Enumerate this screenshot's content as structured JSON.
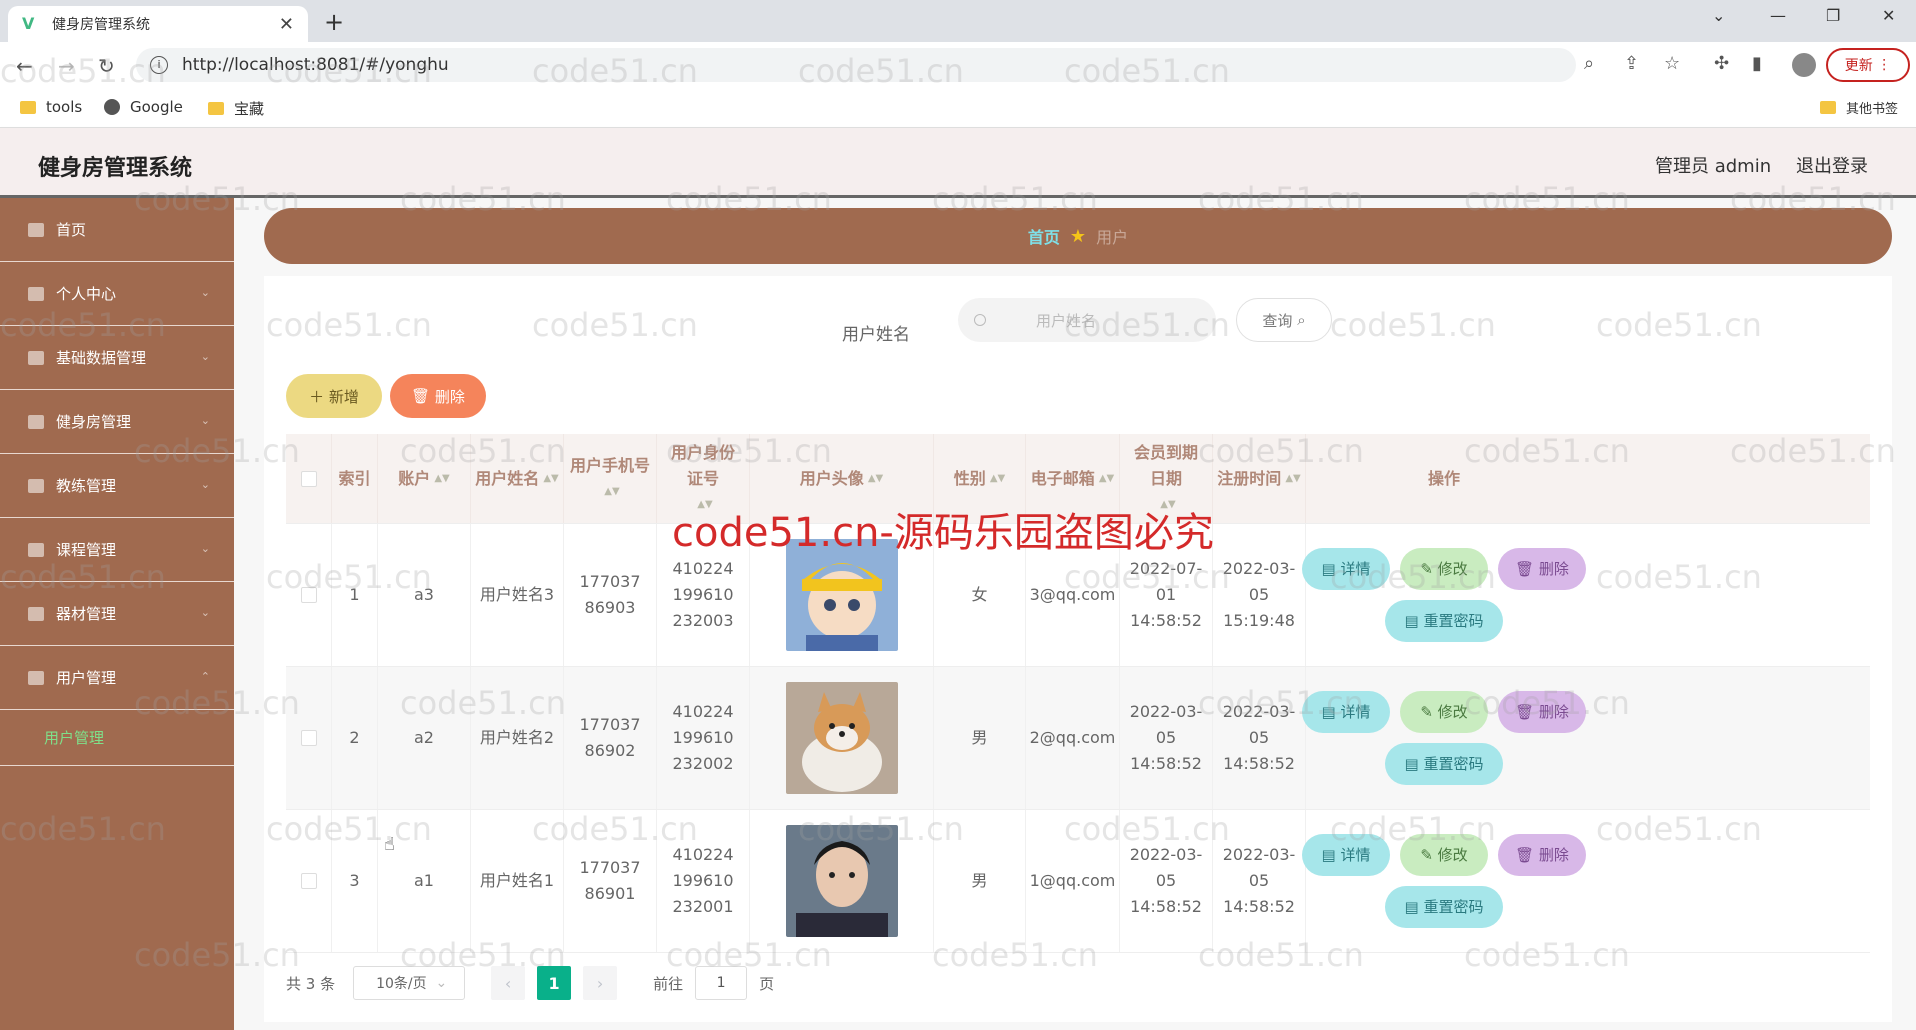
{
  "browser": {
    "tab_title": "健身房管理系统",
    "url": "http://localhost:8081/#/yonghu",
    "update_label": "更新",
    "bookmarks": [
      "tools",
      "Google",
      "宝藏"
    ],
    "other_bookmarks": "其他书签"
  },
  "header": {
    "title": "健身房管理系统",
    "admin": "管理员 admin",
    "logout": "退出登录"
  },
  "sidebar": {
    "items": [
      {
        "label": "首页",
        "icon": "home-icon"
      },
      {
        "label": "个人中心",
        "icon": "user-icon"
      },
      {
        "label": "基础数据管理",
        "icon": "data-icon"
      },
      {
        "label": "健身房管理",
        "icon": "gym-icon"
      },
      {
        "label": "教练管理",
        "icon": "coach-icon"
      },
      {
        "label": "课程管理",
        "icon": "course-icon"
      },
      {
        "label": "器材管理",
        "icon": "equipment-icon"
      },
      {
        "label": "用户管理",
        "icon": "users-icon"
      }
    ],
    "active_sub": "用户管理"
  },
  "breadcrumb": {
    "home": "首页",
    "current": "用户"
  },
  "search": {
    "label": "用户姓名",
    "placeholder": "用户姓名",
    "button": "查询"
  },
  "actions": {
    "add": "新增",
    "delete": "删除"
  },
  "table": {
    "headers": [
      "索引",
      "账户",
      "用户姓名",
      "用户手机号",
      "用户身份证号",
      "用户头像",
      "性别",
      "电子邮箱",
      "会员到期日期",
      "注册时间",
      "操作"
    ],
    "rows": [
      {
        "index": "1",
        "account": "a3",
        "name": "用户姓名3",
        "phone": "17703786903",
        "idcard": "410224199610232003",
        "gender": "女",
        "email": "3@qq.com",
        "expire": "2022-07-01 14:58:52",
        "reg": "2022-03-05 15:19:48"
      },
      {
        "index": "2",
        "account": "a2",
        "name": "用户姓名2",
        "phone": "17703786902",
        "idcard": "410224199610232002",
        "gender": "男",
        "email": "2@qq.com",
        "expire": "2022-03-05 14:58:52",
        "reg": "2022-03-05 14:58:52"
      },
      {
        "index": "3",
        "account": "a1",
        "name": "用户姓名1",
        "phone": "17703786901",
        "idcard": "410224199610232001",
        "gender": "男",
        "email": "1@qq.com",
        "expire": "2022-03-05 14:58:52",
        "reg": "2022-03-05 14:58:52"
      }
    ],
    "ops": {
      "detail": "详情",
      "edit": "修改",
      "delete": "删除",
      "reset": "重置密码"
    }
  },
  "pagination": {
    "total": "共 3 条",
    "size": "10条/页",
    "page": "1",
    "goto": "前往",
    "goto_value": "1",
    "page_unit": "页"
  },
  "watermark": "code51.cn",
  "banner": "code51.cn-源码乐园盗图必究"
}
